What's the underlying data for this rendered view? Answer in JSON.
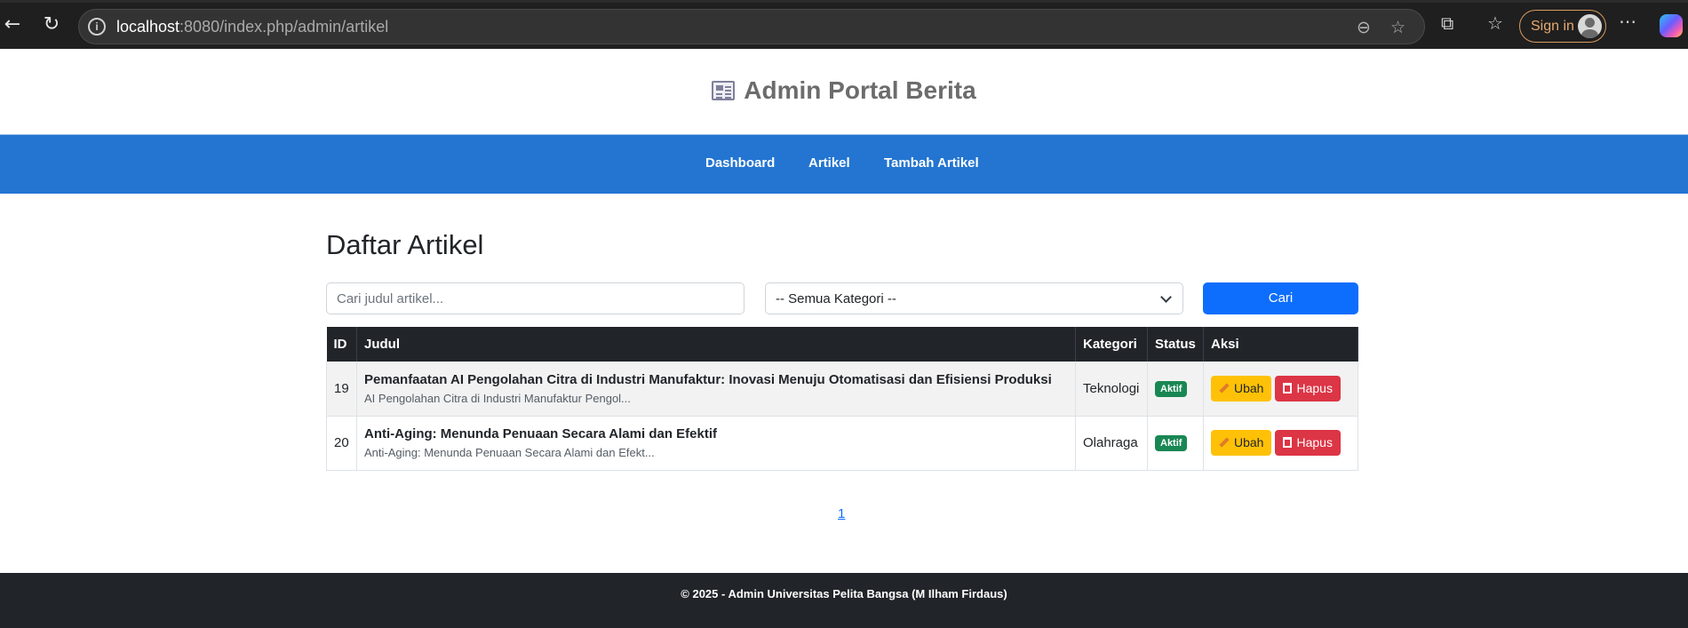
{
  "browser": {
    "url_host": "localhost",
    "url_path": ":8080/index.php/admin/artikel",
    "sign_in_label": "Sign in"
  },
  "header": {
    "title": "Admin Portal Berita",
    "icon": "newspaper-icon"
  },
  "nav": {
    "items": [
      {
        "label": "Dashboard"
      },
      {
        "label": "Artikel"
      },
      {
        "label": "Tambah Artikel"
      }
    ]
  },
  "main": {
    "heading": "Daftar Artikel",
    "search_placeholder": "Cari judul artikel...",
    "category_selected": "-- Semua Kategori --",
    "search_button": "Cari",
    "table": {
      "headers": [
        "ID",
        "Judul",
        "Kategori",
        "Status",
        "Aksi"
      ],
      "rows": [
        {
          "id": "19",
          "title": "Pemanfaatan AI Pengolahan Citra di Industri Manufaktur: Inovasi Menuju Otomatisasi dan Efisiensi Produksi",
          "excerpt": "AI Pengolahan Citra di Industri Manufaktur Pengol...",
          "category": "Teknologi",
          "status": "Aktif",
          "edit_label": "Ubah",
          "delete_label": "Hapus"
        },
        {
          "id": "20",
          "title": "Anti-Aging: Menunda Penuaan Secara Alami dan Efektif",
          "excerpt": "Anti-Aging: Menunda Penuaan Secara Alami dan Efekt...",
          "category": "Olahraga",
          "status": "Aktif",
          "edit_label": "Ubah",
          "delete_label": "Hapus"
        }
      ]
    },
    "pagination": {
      "page": "1"
    }
  },
  "footer": {
    "text": "© 2025 - Admin Universitas Pelita Bangsa (M Ilham Firdaus)"
  },
  "colors": {
    "nav_bg": "#2375d1",
    "primary": "#0d6efd",
    "warning": "#ffc107",
    "danger": "#dc3545",
    "success": "#198754",
    "dark": "#212529"
  }
}
